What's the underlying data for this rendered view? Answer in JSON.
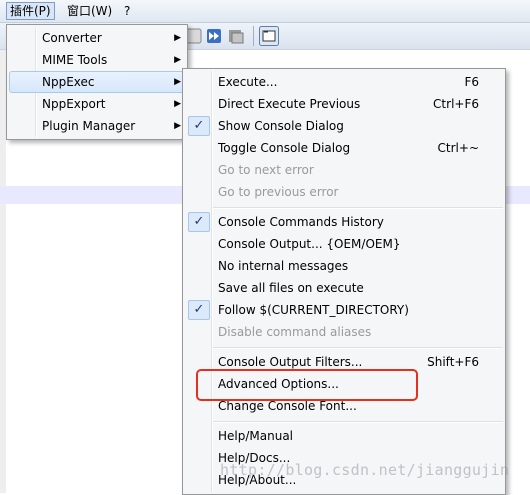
{
  "menubar": {
    "items": [
      "插件(P)",
      "窗口(W)",
      "?"
    ]
  },
  "toolbar": {
    "icons": [
      "play-icon",
      "fast-forward-icon",
      "macro-icon",
      "console-icon"
    ]
  },
  "plugins_menu": {
    "items": [
      {
        "label": "Converter",
        "submenu": true
      },
      {
        "label": "MIME Tools",
        "submenu": true
      },
      {
        "label": "NppExec",
        "submenu": true
      },
      {
        "label": "NppExport",
        "submenu": true
      },
      {
        "label": "Plugin Manager",
        "submenu": true
      }
    ]
  },
  "nppexec_menu": {
    "items": [
      {
        "label": "Execute...",
        "shortcut": "F6"
      },
      {
        "label": "Direct Execute Previous",
        "shortcut": "Ctrl+F6"
      },
      {
        "label": "Show Console Dialog",
        "checked": true
      },
      {
        "label": "Toggle Console Dialog",
        "shortcut": "Ctrl+~"
      },
      {
        "label": "Go to next error",
        "disabled": true
      },
      {
        "label": "Go to previous error",
        "disabled": true
      },
      {
        "label": "Console Commands History",
        "checked": true
      },
      {
        "label": "Console Output... {OEM/OEM}"
      },
      {
        "label": "No internal messages"
      },
      {
        "label": "Save all files on execute"
      },
      {
        "label": "Follow $(CURRENT_DIRECTORY)",
        "checked": true
      },
      {
        "label": "Disable command aliases",
        "disabled": true
      },
      {
        "label": "Console Output Filters...",
        "shortcut": "Shift+F6"
      },
      {
        "label": "Advanced Options..."
      },
      {
        "label": "Change Console Font..."
      },
      {
        "label": "Help/Manual"
      },
      {
        "label": "Help/Docs..."
      },
      {
        "label": "Help/About..."
      }
    ]
  },
  "watermark": "http://blog.csdn.net/jianggujin",
  "colors": {
    "highlight_box": "#e5301f",
    "menu_bg": "#f5f6f7",
    "hover": "#d6e7fb"
  }
}
